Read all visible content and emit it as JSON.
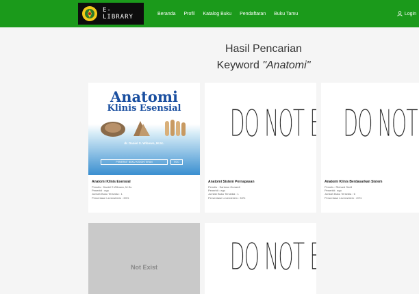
{
  "navbar": {
    "brand_line1": "E-",
    "brand_line2": "LIBRARY",
    "menu": [
      "Beranda",
      "Profil",
      "Katalog Buku",
      "Pendaftaran",
      "Buku Tamu"
    ],
    "login_label": "Login"
  },
  "heading": {
    "line1": "Hasil Pencarian",
    "prefix": "Keyword ",
    "keyword": "\"Anatomi\""
  },
  "books": [
    {
      "title": "Anatomi Klinis Esensial",
      "penulis": "Penulis : Daniel S Wibowo, M.Sc.",
      "penerbit": "Penerbit : ego",
      "jumlah": "Jumlah Buku Tersedia : 1",
      "persentase": "Persentase Levenshtein : 33%",
      "cover_title": "Anatomi",
      "cover_subtitle": "Klinis Esensial",
      "cover_author": "dr. Daniel S. Wibowo, M.Sc.",
      "cover_publisher": "PENERBIT BUKU KEDOKTERAN",
      "cover_publisher_badge": "EGC"
    },
    {
      "title": "Anatomi Sistem Pernapasan",
      "penulis": "Penulis : Santoso Gunardi",
      "penerbit": "Penerbit : ego",
      "jumlah": "Jumlah Buku Tersedia : 1",
      "persentase": "Persentase Levenshtein : 33%",
      "cover_text": "DO NOT EXIST"
    },
    {
      "title": "Anatomi Klinis Berdasarkan Sistem",
      "penulis": "Penulis : Richard Snell",
      "penerbit": "Penerbit : ego",
      "jumlah": "Jumlah Buku Tersedia : 6",
      "persentase": "Persentase Levenshtein : 20%",
      "cover_text": "DO NOT EXIST"
    },
    {
      "cover_text": "Not Exist"
    },
    {
      "cover_text": "DO NOT EXIST"
    }
  ],
  "colors": {
    "navbar": "#1b9a1b",
    "brand_bg": "#0d0d0d",
    "logo": "#f2c91b"
  },
  "icons": {
    "login": "user-icon",
    "logo": "university-logo-icon"
  }
}
